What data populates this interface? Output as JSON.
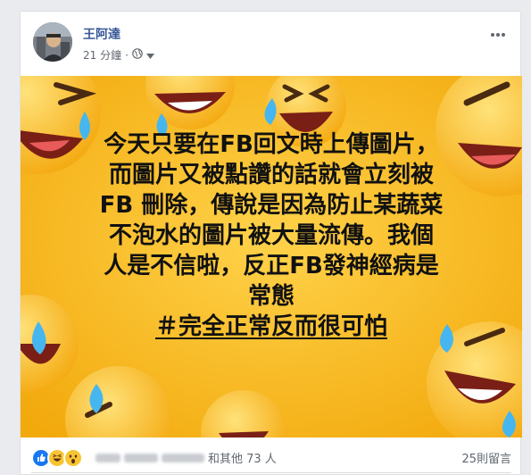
{
  "post": {
    "author": "王阿達",
    "time": "21 分鐘",
    "privacy_icon": "globe-icon",
    "menu_icon": "more-icon",
    "text_lines": [
      "今天只要在FB回文時上傳圖片，",
      "而圖片又被點讚的話就會立刻被",
      "FB 刪除，傳說是因為防止某蔬菜",
      "不泡水的圖片被大量流傳。我個",
      "人是不信啦，反正FB發神經病是",
      "常態"
    ],
    "hashtag": "＃完全正常反而很可怕",
    "background_color": "#f7b716"
  },
  "footer": {
    "reaction_icons": [
      "like-icon",
      "haha-icon",
      "wow-icon"
    ],
    "others_text": "和其他 73 人",
    "comments_text": "25則留言"
  }
}
